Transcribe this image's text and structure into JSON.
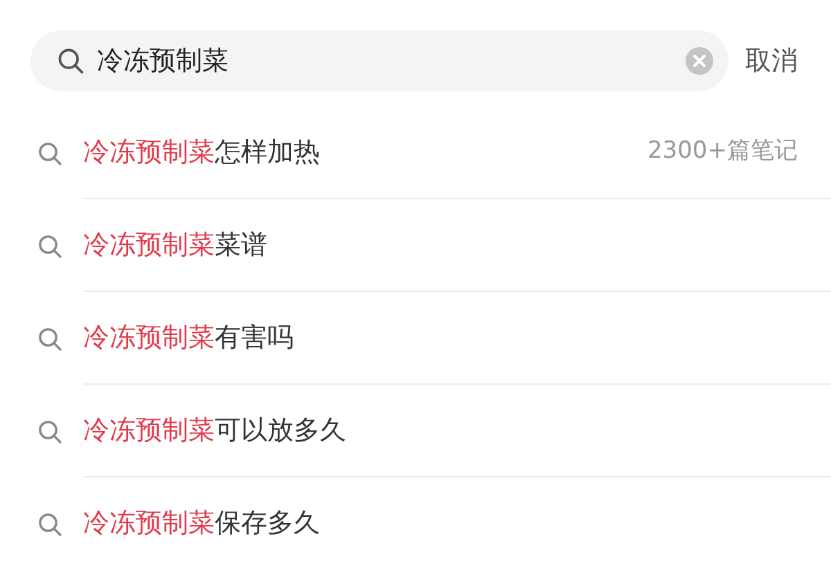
{
  "search": {
    "value": "冷冻预制菜",
    "cancel": "取消"
  },
  "suggestions": [
    {
      "match": "冷冻预制菜",
      "rest": "怎样加热",
      "count": "2300+篇笔记"
    },
    {
      "match": "冷冻预制菜",
      "rest": "菜谱"
    },
    {
      "match": "冷冻预制菜",
      "rest": "有害吗"
    },
    {
      "match": "冷冻预制菜",
      "rest": "可以放多久"
    },
    {
      "match": "冷冻预制菜",
      "rest": "保存多久"
    }
  ]
}
